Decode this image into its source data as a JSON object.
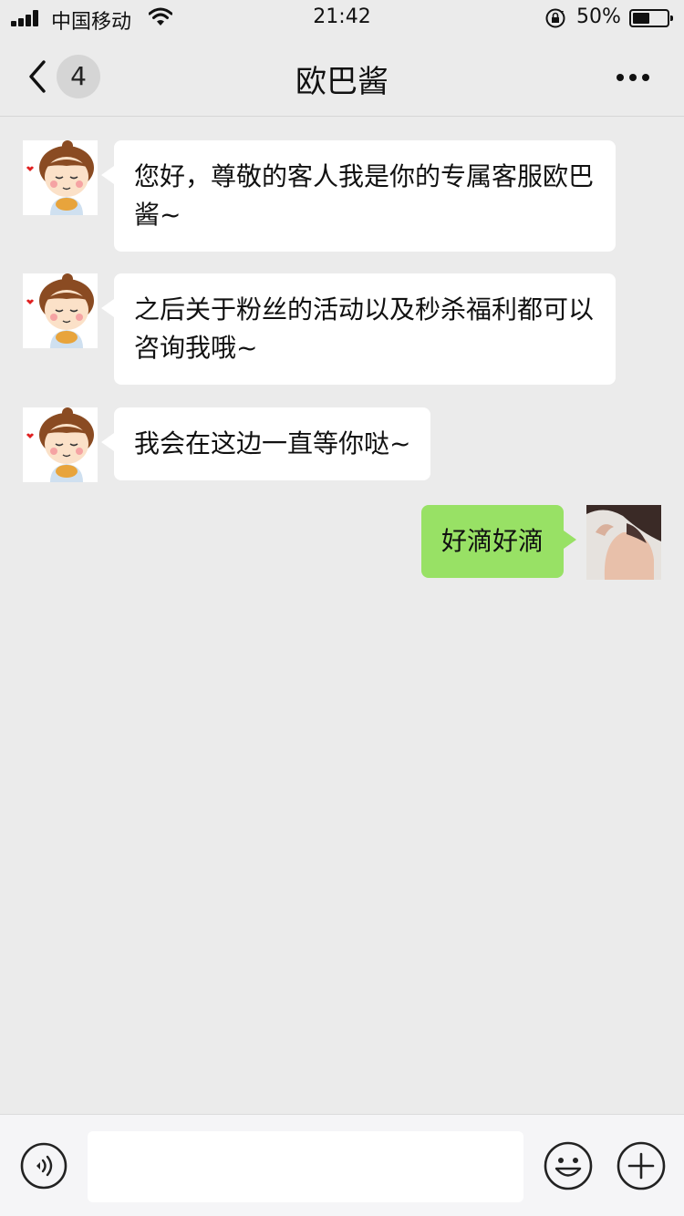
{
  "status_bar": {
    "carrier": "中国移动",
    "time": "21:42",
    "battery_percent": "50%",
    "battery_level": 0.5
  },
  "nav": {
    "unread_count": "4",
    "title": "欧巴酱"
  },
  "messages": [
    {
      "from": "contact",
      "text": "您好，尊敬的客人我是你的专属客服欧巴酱~"
    },
    {
      "from": "contact",
      "text": "之后关于粉丝的活动以及秒杀福利都可以咨询我哦~"
    },
    {
      "from": "contact",
      "text": "我会在这边一直等你哒~"
    },
    {
      "from": "me",
      "text": "好滴好滴"
    }
  ],
  "input": {
    "value": "",
    "placeholder": ""
  },
  "colors": {
    "background": "#ebebeb",
    "sent_bubble": "#98e165",
    "received_bubble": "#ffffff"
  },
  "icons": {
    "back": "chevron-left-icon",
    "more": "more-dots-icon",
    "voice": "voice-icon",
    "emoji": "emoji-icon",
    "add": "plus-icon"
  }
}
